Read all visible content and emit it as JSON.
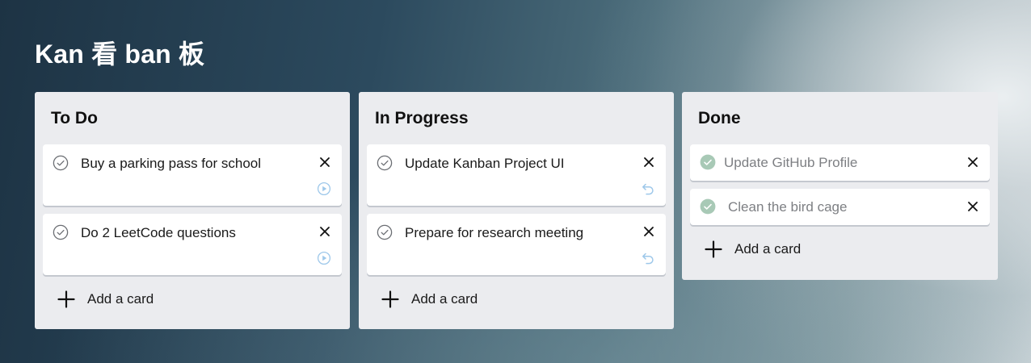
{
  "board": {
    "title": "Kan 看 ban 板"
  },
  "columns": [
    {
      "title": "To Do",
      "cards": [
        {
          "text": "Buy a parking pass for school",
          "status_icon": "circle-check-icon",
          "action_icon": "play-circle-icon"
        },
        {
          "text": "Do 2 LeetCode questions",
          "status_icon": "circle-check-icon",
          "action_icon": "play-circle-icon"
        }
      ],
      "add_card_label": "Add a card"
    },
    {
      "title": "In Progress",
      "cards": [
        {
          "text": "Update Kanban Project UI",
          "status_icon": "circle-check-icon",
          "action_icon": "undo-icon"
        },
        {
          "text": "Prepare for research meeting",
          "status_icon": "circle-check-icon",
          "action_icon": "undo-icon"
        }
      ],
      "add_card_label": "Add a card"
    },
    {
      "title": "Done",
      "cards": [
        {
          "text": "Update GitHub Profile",
          "status_icon": "filled-check-icon"
        },
        {
          "text": "Clean the bird cage",
          "status_icon": "filled-check-icon"
        }
      ],
      "add_card_label": "Add a card"
    }
  ],
  "colors": {
    "column_bg": "#ebecef",
    "card_bg": "#ffffff",
    "done_check": "#a8c9b6",
    "action_icon": "#9ec8ea",
    "done_text": "#7d7f83"
  }
}
